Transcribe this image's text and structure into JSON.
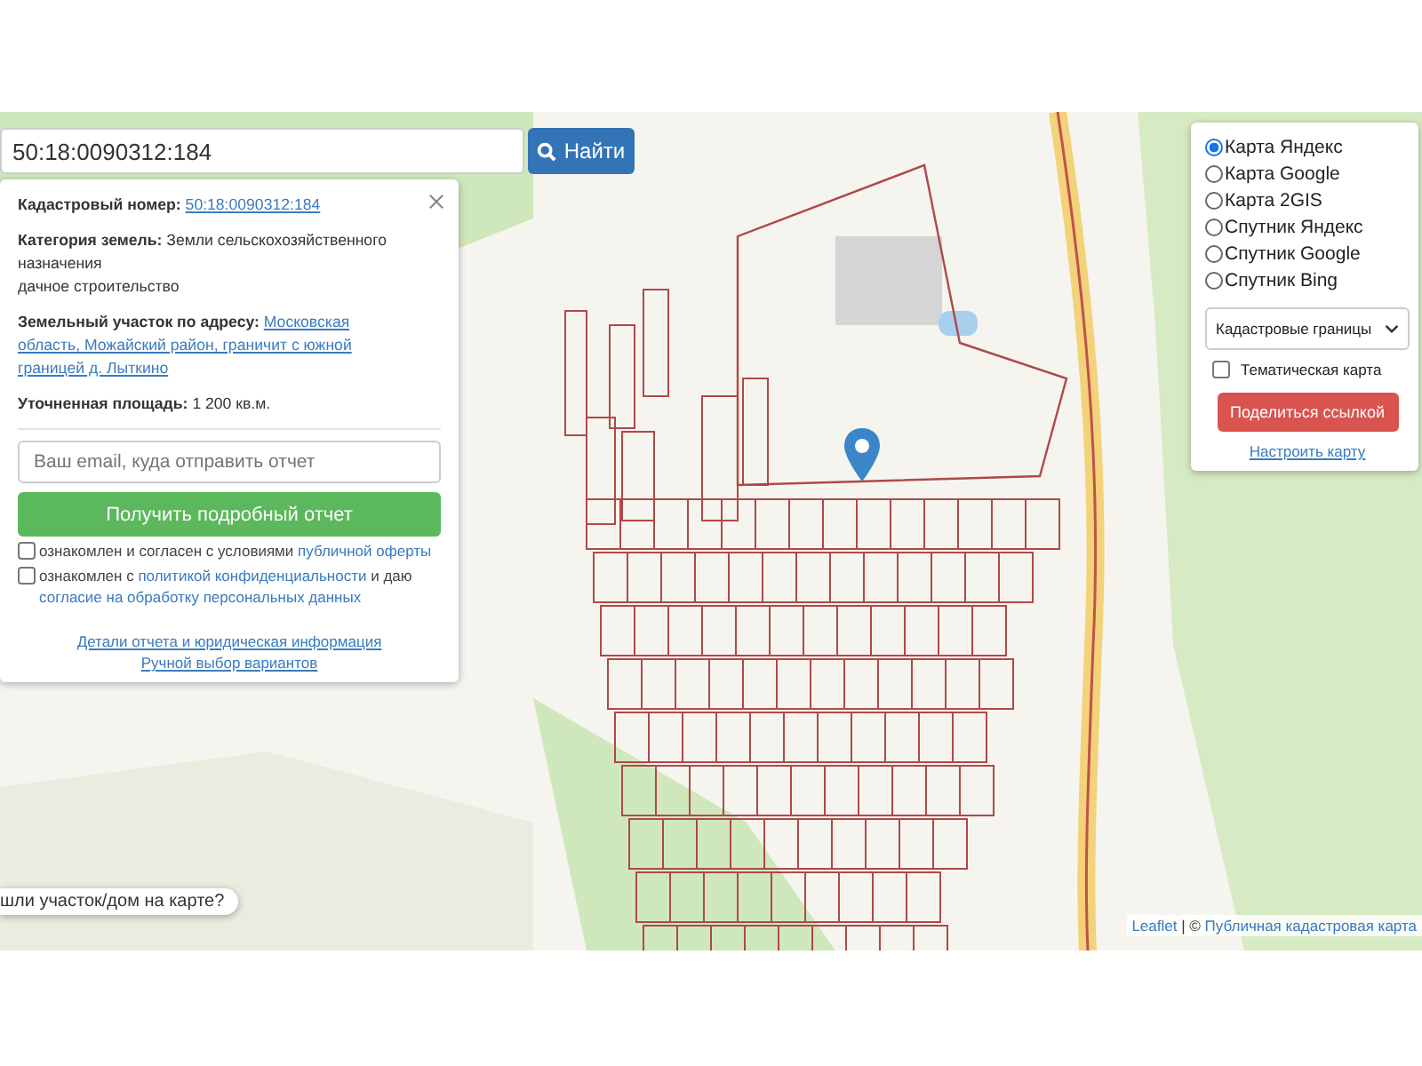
{
  "search": {
    "value": "50:18:0090312:184",
    "button": "Найти"
  },
  "info": {
    "fields": [
      {
        "label": "Кадастровый номер:",
        "kind": "link",
        "lines": [
          "50:18:0090312:184"
        ]
      },
      {
        "label": "Категория земель:",
        "kind": "text",
        "lines": [
          "Земли сельскохозяйственного назначения",
          "дачное строительство"
        ]
      },
      {
        "label": "Земельный участок по адресу:",
        "kind": "link",
        "lines": [
          "Московская область, Можайский район, граничит с южной границей д. Лыткино"
        ]
      },
      {
        "label": "Уточненная площадь:",
        "kind": "text",
        "lines": [
          "1 200 кв.м."
        ]
      }
    ],
    "email": {
      "placeholder": "Ваш email, куда отправить отчет"
    },
    "submit": "Получить подробный отчет",
    "consents": [
      {
        "checked": false,
        "parts": [
          {
            "text": "ознакомлен и согласен с условиями ",
            "link": false
          },
          {
            "text": "публичной оферты",
            "link": true
          }
        ]
      },
      {
        "checked": false,
        "parts": [
          {
            "text": "ознакомлен с ",
            "link": false
          },
          {
            "text": "политикой конфиденциальности",
            "link": true
          },
          {
            "text": " и даю ",
            "link": false
          },
          {
            "text": "согласие на обработку персональных данных",
            "link": true
          }
        ]
      }
    ],
    "footer_links": [
      "Детали отчета и юридическая информация",
      "Ручной выбор вариантов"
    ]
  },
  "layers": {
    "radios": [
      {
        "label": "Карта Яндекс",
        "selected": true
      },
      {
        "label": "Карта Google",
        "selected": false
      },
      {
        "label": "Карта 2GIS",
        "selected": false
      },
      {
        "label": "Спутник Яндекс",
        "selected": false
      },
      {
        "label": "Спутник Google",
        "selected": false
      },
      {
        "label": "Спутник Bing",
        "selected": false
      }
    ],
    "select": "Кадастровые границы",
    "thematic": {
      "label": "Тематическая карта",
      "checked": false
    },
    "share": "Поделиться ссылкой",
    "settings": "Настроить карту"
  },
  "prompt": "шли участок/дом на карте?",
  "attribution": [
    {
      "text": "Leaflet",
      "link": true
    },
    {
      "text": " | © ",
      "link": false
    },
    {
      "text": "Публичная кадастровая карта",
      "link": true
    }
  ]
}
